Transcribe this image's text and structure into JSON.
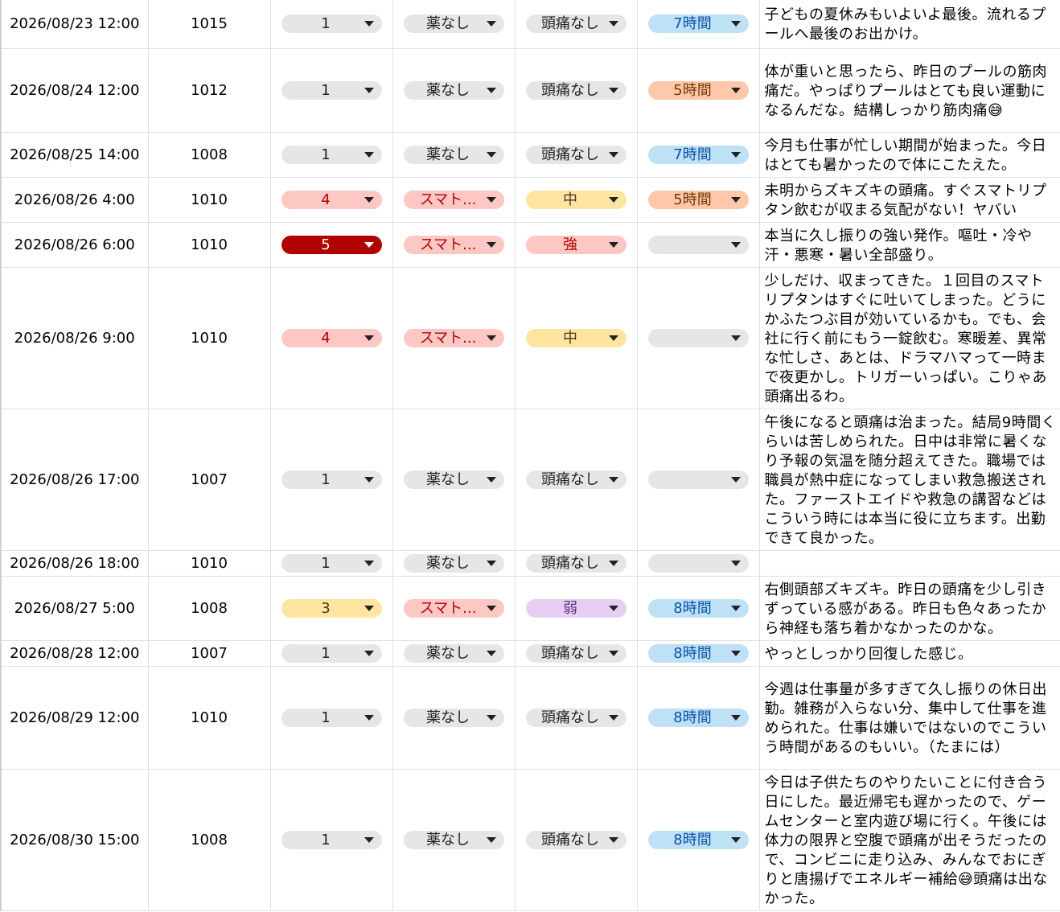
{
  "colors": {
    "gray": {
      "bg": "#e6e6e6",
      "fg": "#222222"
    },
    "red_light": {
      "bg": "#fdc7c4",
      "fg": "#b10202"
    },
    "red_dark": {
      "bg": "#b10202",
      "fg": "#ffffff"
    },
    "yellow": {
      "bg": "#ffe5a0",
      "fg": "#473821"
    },
    "purple": {
      "bg": "#e6cff2",
      "fg": "#5a3286"
    },
    "blue": {
      "bg": "#bfe1f6",
      "fg": "#0a53a8"
    },
    "orange": {
      "bg": "#ffc8aa",
      "fg": "#753800"
    }
  },
  "icons": {
    "dropdown": "triangle-down-icon",
    "emoji": "grinning-face-with-sweat-icon"
  },
  "rows": [
    {
      "date": "2026/08/23 12:00",
      "pressure": "1015",
      "level": "1",
      "level_color": "gray",
      "medicine": "薬なし",
      "med_color": "gray",
      "pain": "頭痛なし",
      "pain_color": "gray",
      "sleep": "7時間",
      "sleep_color": "blue",
      "note": "子どもの夏休みもいよいよ最後。流れるプールへ最後のお出かけ。"
    },
    {
      "date": "2026/08/24 12:00",
      "pressure": "1012",
      "level": "1",
      "level_color": "gray",
      "medicine": "薬なし",
      "med_color": "gray",
      "pain": "頭痛なし",
      "pain_color": "gray",
      "sleep": "5時間",
      "sleep_color": "orange",
      "note": "体が重いと思ったら、昨日のプールの筋肉痛だ。やっぱりプールはとても良い運動になるんだな。結構しっかり筋肉痛😅"
    },
    {
      "date": "2026/08/25 14:00",
      "pressure": "1008",
      "level": "1",
      "level_color": "gray",
      "medicine": "薬なし",
      "med_color": "gray",
      "pain": "頭痛なし",
      "pain_color": "gray",
      "sleep": "7時間",
      "sleep_color": "blue",
      "note": "今月も仕事が忙しい期間が始まった。今日はとても暑かったので体にこたえた。"
    },
    {
      "date": "2026/08/26 4:00",
      "pressure": "1010",
      "level": "4",
      "level_color": "red_light",
      "medicine": "スマト...",
      "med_color": "red_light",
      "pain": "中",
      "pain_color": "yellow",
      "sleep": "5時間",
      "sleep_color": "orange",
      "note": "未明からズキズキの頭痛。すぐスマトリプタン飲むが収まる気配がない！ヤバい"
    },
    {
      "date": "2026/08/26 6:00",
      "pressure": "1010",
      "level": "5",
      "level_color": "red_dark",
      "medicine": "スマト...",
      "med_color": "red_light",
      "pain": "強",
      "pain_color": "red_light",
      "sleep": "",
      "sleep_color": "gray",
      "note": "本当に久し振りの強い発作。嘔吐・冷や汗・悪寒・暑い全部盛り。"
    },
    {
      "date": "2026/08/26 9:00",
      "pressure": "1010",
      "level": "4",
      "level_color": "red_light",
      "medicine": "スマト...",
      "med_color": "red_light",
      "pain": "中",
      "pain_color": "yellow",
      "sleep": "",
      "sleep_color": "gray",
      "note": "少しだけ、収まってきた。１回目のスマトリプタンはすぐに吐いてしまった。どうにかふたつぶ目が効いているかも。でも、会社に行く前にもう一錠飲む。寒暖差、異常な忙しさ、あとは、ドラマハマって一時まで夜更かし。トリガーいっぱい。こりゃあ頭痛出るわ。"
    },
    {
      "date": "2026/08/26 17:00",
      "pressure": "1007",
      "level": "1",
      "level_color": "gray",
      "medicine": "薬なし",
      "med_color": "gray",
      "pain": "頭痛なし",
      "pain_color": "gray",
      "sleep": "",
      "sleep_color": "gray",
      "note": "午後になると頭痛は治まった。結局9時間くらいは苦しめられた。日中は非常に暑くなり予報の気温を随分超えてきた。職場では職員が熱中症になってしまい救急搬送された。ファーストエイドや救急の講習などはこういう時には本当に役に立ちます。出勤できて良かった。"
    },
    {
      "date": "2026/08/26 18:00",
      "pressure": "1010",
      "level": "1",
      "level_color": "gray",
      "medicine": "薬なし",
      "med_color": "gray",
      "pain": "頭痛なし",
      "pain_color": "gray",
      "sleep": "",
      "sleep_color": "gray",
      "note": ""
    },
    {
      "date": "2026/08/27 5:00",
      "pressure": "1008",
      "level": "3",
      "level_color": "yellow",
      "medicine": "スマト...",
      "med_color": "red_light",
      "pain": "弱",
      "pain_color": "purple",
      "sleep": "8時間",
      "sleep_color": "blue",
      "note": "右側頭部ズキズキ。昨日の頭痛を少し引きずっている感がある。昨日も色々あったから神経も落ち着かなかったのかな。"
    },
    {
      "date": "2026/08/28 12:00",
      "pressure": "1007",
      "level": "1",
      "level_color": "gray",
      "medicine": "薬なし",
      "med_color": "gray",
      "pain": "頭痛なし",
      "pain_color": "gray",
      "sleep": "8時間",
      "sleep_color": "blue",
      "note": "やっとしっかり回復した感じ。"
    },
    {
      "date": "2026/08/29 12:00",
      "pressure": "1010",
      "level": "1",
      "level_color": "gray",
      "medicine": "薬なし",
      "med_color": "gray",
      "pain": "頭痛なし",
      "pain_color": "gray",
      "sleep": "8時間",
      "sleep_color": "blue",
      "note": "今週は仕事量が多すぎて久し振りの休日出勤。雑務が入らない分、集中して仕事を進められた。仕事は嫌いではないのでこういう時間があるのもいい。（たまには）"
    },
    {
      "date": "2026/08/30 15:00",
      "pressure": "1008",
      "level": "1",
      "level_color": "gray",
      "medicine": "薬なし",
      "med_color": "gray",
      "pain": "頭痛なし",
      "pain_color": "gray",
      "sleep": "8時間",
      "sleep_color": "blue",
      "note": "今日は子供たちのやりたいことに付き合う日にした。最近帰宅も遅かったので、ゲームセンターと室内遊び場に行く。午後には体力の限界と空腹で頭痛が出そうだったので、コンビニに走り込み、みんなでおにぎりと唐揚げでエネルギー補給😅頭痛は出なかった。"
    }
  ]
}
